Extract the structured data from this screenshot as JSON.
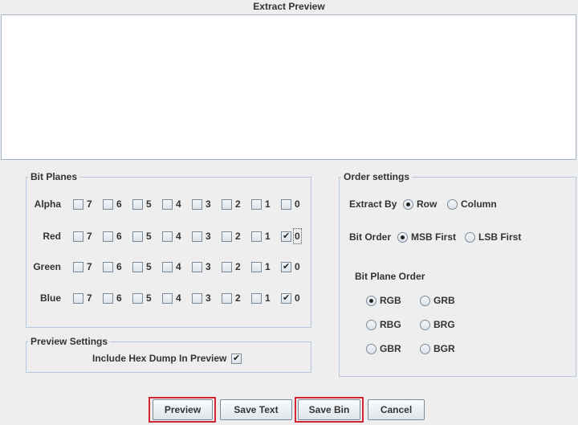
{
  "title": "Extract Preview",
  "preview_text": "",
  "bit_planes": {
    "legend": "Bit Planes",
    "bits": [
      "7",
      "6",
      "5",
      "4",
      "3",
      "2",
      "1",
      "0"
    ],
    "rows": [
      {
        "label": "Alpha",
        "checked_bits": []
      },
      {
        "label": "Red",
        "checked_bits": [
          "0"
        ]
      },
      {
        "label": "Green",
        "checked_bits": [
          "0"
        ]
      },
      {
        "label": "Blue",
        "checked_bits": [
          "0"
        ]
      }
    ]
  },
  "preview_settings": {
    "legend": "Preview Settings",
    "hex_dump_label": "Include Hex Dump In Preview",
    "hex_dump_checked": true
  },
  "order_settings": {
    "legend": "Order settings",
    "extract_by": {
      "label": "Extract By",
      "options": [
        "Row",
        "Column"
      ],
      "selected": "Row"
    },
    "bit_order": {
      "label": "Bit Order",
      "options": [
        "MSB First",
        "LSB First"
      ],
      "selected": "MSB First"
    },
    "bit_plane_order": {
      "label": "Bit Plane Order",
      "options": [
        "RGB",
        "GRB",
        "RBG",
        "BRG",
        "GBR",
        "BGR"
      ],
      "selected": "RGB"
    }
  },
  "buttons": {
    "preview": "Preview",
    "save_text": "Save Text",
    "save_bin": "Save Bin",
    "cancel": "Cancel"
  },
  "colors": {
    "highlight": "#d32632",
    "background": "#eeeeee",
    "border": "#b8c9dc"
  }
}
